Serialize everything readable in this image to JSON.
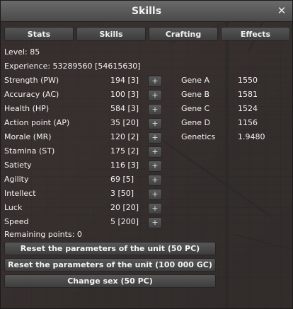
{
  "window": {
    "title": "Skills",
    "close_label": "✕"
  },
  "tabs": [
    {
      "label": "Stats"
    },
    {
      "label": "Skills"
    },
    {
      "label": "Crafting"
    },
    {
      "label": "Effects"
    }
  ],
  "info": {
    "level": "Level: 85",
    "experience": "Experience: 53289560 [54615630]"
  },
  "stats": [
    {
      "name": "Strength (PW)",
      "value": "194 [3]"
    },
    {
      "name": "Accuracy (AC)",
      "value": "100 [3]"
    },
    {
      "name": "Health (HP)",
      "value": "584 [3]"
    },
    {
      "name": "Action point (AP)",
      "value": "35 [20]"
    },
    {
      "name": "Morale (MR)",
      "value": "120 [2]"
    },
    {
      "name": "Stamina (ST)",
      "value": "175 [2]"
    },
    {
      "name": "Satiety",
      "value": "116 [3]"
    },
    {
      "name": "Agility",
      "value": "69 [5]"
    },
    {
      "name": "Intellect",
      "value": "3 [50]"
    },
    {
      "name": "Luck",
      "value": "20 [20]"
    },
    {
      "name": "Speed",
      "value": "5 [200]"
    }
  ],
  "plus_label": "+",
  "genes": [
    {
      "name": "Gene A",
      "value": "1550"
    },
    {
      "name": "Gene B",
      "value": "1581"
    },
    {
      "name": "Gene C",
      "value": "1524"
    },
    {
      "name": "Gene D",
      "value": "1156"
    },
    {
      "name": "Genetics",
      "value": "1.9480"
    }
  ],
  "remaining_points": "Remaining points: 0",
  "actions": [
    {
      "label": "Reset the parameters of the unit (50 PC)"
    },
    {
      "label": "Reset the parameters of the unit (100 000 GC)"
    },
    {
      "label": "Change sex (50 PC)"
    }
  ]
}
